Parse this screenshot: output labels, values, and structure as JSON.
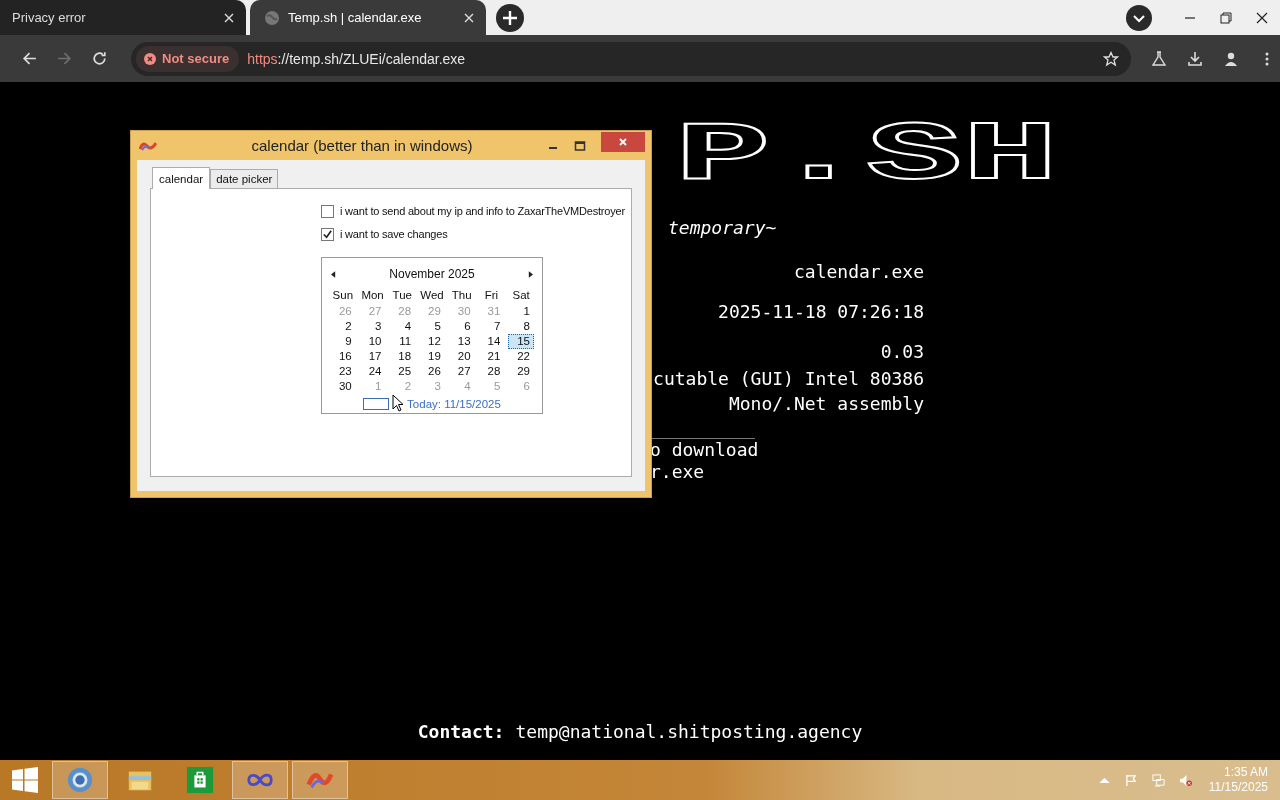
{
  "browser": {
    "tabs": [
      {
        "title": "Privacy error",
        "selected": false,
        "kind": "plain"
      },
      {
        "title": "Temp.sh | calendar.exe",
        "selected": true,
        "kind": "globe"
      }
    ],
    "nav_buttons": [
      {
        "kind": "back",
        "disabled": false
      },
      {
        "kind": "forward",
        "disabled": true
      },
      {
        "kind": "reload",
        "disabled": false
      }
    ],
    "security_label": "Not secure",
    "url_scheme": "https",
    "url_rest": "://temp.sh/ZLUEi/calendar.exe"
  },
  "page": {
    "logo": "P.SH",
    "tagline": "temporary~",
    "info_lines": [
      "calendar.exe",
      "2025-11-18 07:26:18",
      "0.03",
      "cutable (GUI) Intel 80386",
      "Mono/.Net assembly"
    ],
    "download_lines": [
      "o download",
      "r.exe"
    ],
    "contact_label": "Contact:",
    "contact_email": "temp@national.shitposting.agency"
  },
  "app_window": {
    "title": "calendar (better than in windows)",
    "tabs": [
      {
        "label": "calendar",
        "selected": true
      },
      {
        "label": "date picker",
        "selected": false
      }
    ],
    "checkboxes": [
      {
        "label": "i want to send about my ip and info to ZaxarTheVMDestroyer",
        "checked": false
      },
      {
        "label": "i want to save changes",
        "checked": true
      }
    ],
    "calendar": {
      "month": "November 2025",
      "weekdays": [
        "Sun",
        "Mon",
        "Tue",
        "Wed",
        "Thu",
        "Fri",
        "Sat"
      ],
      "weeks": [
        [
          {
            "d": "26",
            "other": true,
            "selected": false
          },
          {
            "d": "27",
            "other": true,
            "selected": false
          },
          {
            "d": "28",
            "other": true,
            "selected": false
          },
          {
            "d": "29",
            "other": true,
            "selected": false
          },
          {
            "d": "30",
            "other": true,
            "selected": false
          },
          {
            "d": "31",
            "other": true,
            "selected": false
          },
          {
            "d": "1",
            "other": false,
            "selected": false
          }
        ],
        [
          {
            "d": "2",
            "other": false,
            "selected": false
          },
          {
            "d": "3",
            "other": false,
            "selected": false
          },
          {
            "d": "4",
            "other": false,
            "selected": false
          },
          {
            "d": "5",
            "other": false,
            "selected": false
          },
          {
            "d": "6",
            "other": false,
            "selected": false
          },
          {
            "d": "7",
            "other": false,
            "selected": false
          },
          {
            "d": "8",
            "other": false,
            "selected": false
          }
        ],
        [
          {
            "d": "9",
            "other": false,
            "selected": false
          },
          {
            "d": "10",
            "other": false,
            "selected": false
          },
          {
            "d": "11",
            "other": false,
            "selected": false
          },
          {
            "d": "12",
            "other": false,
            "selected": false
          },
          {
            "d": "13",
            "other": false,
            "selected": false
          },
          {
            "d": "14",
            "other": false,
            "selected": false
          },
          {
            "d": "15",
            "other": false,
            "selected": true
          }
        ],
        [
          {
            "d": "16",
            "other": false,
            "selected": false
          },
          {
            "d": "17",
            "other": false,
            "selected": false
          },
          {
            "d": "18",
            "other": false,
            "selected": false
          },
          {
            "d": "19",
            "other": false,
            "selected": false
          },
          {
            "d": "20",
            "other": false,
            "selected": false
          },
          {
            "d": "21",
            "other": false,
            "selected": false
          },
          {
            "d": "22",
            "other": false,
            "selected": false
          }
        ],
        [
          {
            "d": "23",
            "other": false,
            "selected": false
          },
          {
            "d": "24",
            "other": false,
            "selected": false
          },
          {
            "d": "25",
            "other": false,
            "selected": false
          },
          {
            "d": "26",
            "other": false,
            "selected": false
          },
          {
            "d": "27",
            "other": false,
            "selected": false
          },
          {
            "d": "28",
            "other": false,
            "selected": false
          },
          {
            "d": "29",
            "other": false,
            "selected": false
          }
        ],
        [
          {
            "d": "30",
            "other": false,
            "selected": false
          },
          {
            "d": "1",
            "other": true,
            "selected": false
          },
          {
            "d": "2",
            "other": true,
            "selected": false
          },
          {
            "d": "3",
            "other": true,
            "selected": false
          },
          {
            "d": "4",
            "other": true,
            "selected": false
          },
          {
            "d": "5",
            "other": true,
            "selected": false
          },
          {
            "d": "6",
            "other": true,
            "selected": false
          }
        ]
      ],
      "today": "Today: 11/15/2025"
    }
  },
  "taskbar": {
    "apps": [
      {
        "kind": "browser",
        "active": true
      },
      {
        "kind": "folder",
        "active": false
      },
      {
        "kind": "store",
        "active": false
      },
      {
        "kind": "infinity",
        "active": true
      },
      {
        "kind": "calendar",
        "active": true
      }
    ],
    "time": "1:35 AM",
    "date": "11/15/2025"
  }
}
